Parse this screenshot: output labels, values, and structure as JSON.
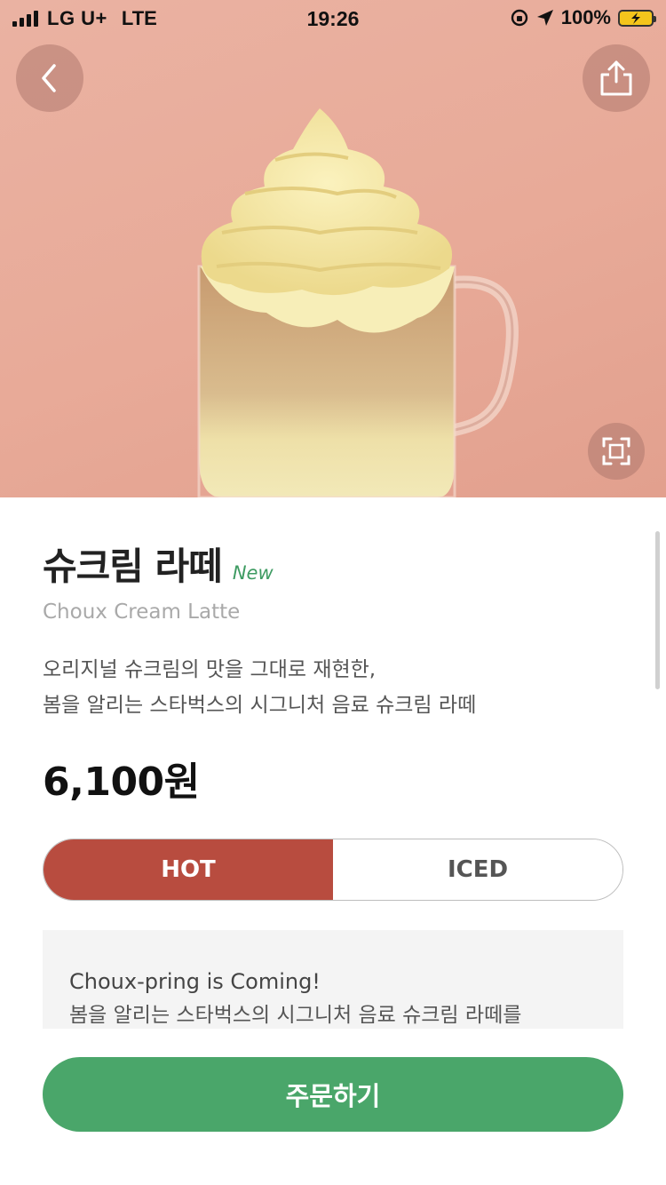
{
  "status_bar": {
    "carrier": "LG U+",
    "network": "LTE",
    "time": "19:26",
    "battery": "100%",
    "icons": [
      "signal-icon",
      "orientation-lock-icon",
      "location-arrow-icon",
      "battery-charging-icon"
    ]
  },
  "hero": {
    "image": "choux-cream-latte-mug-photo",
    "background_color": "#e8aa98"
  },
  "product": {
    "name_ko": "슈크림 라떼",
    "new_badge": "New",
    "name_en": "Choux Cream Latte",
    "description_line1": "오리지널 슈크림의 맛을 그대로 재현한,",
    "description_line2": "봄을 알리는 스타벅스의 시그니처 음료 슈크림 라떼",
    "price": "6,100원"
  },
  "temperature_toggle": {
    "hot_label": "HOT",
    "iced_label": "ICED",
    "selected": "HOT"
  },
  "info_box": {
    "heading": "Choux-pring is Coming!",
    "line1": "봄을 알리는 스타벅스의 시그니처 음료 슈크림 라떼를"
  },
  "order_button": {
    "label": "주문하기"
  },
  "colors": {
    "accent_green": "#4aa66a",
    "hot_red": "#b84c3f",
    "new_green": "#3e9b62"
  }
}
